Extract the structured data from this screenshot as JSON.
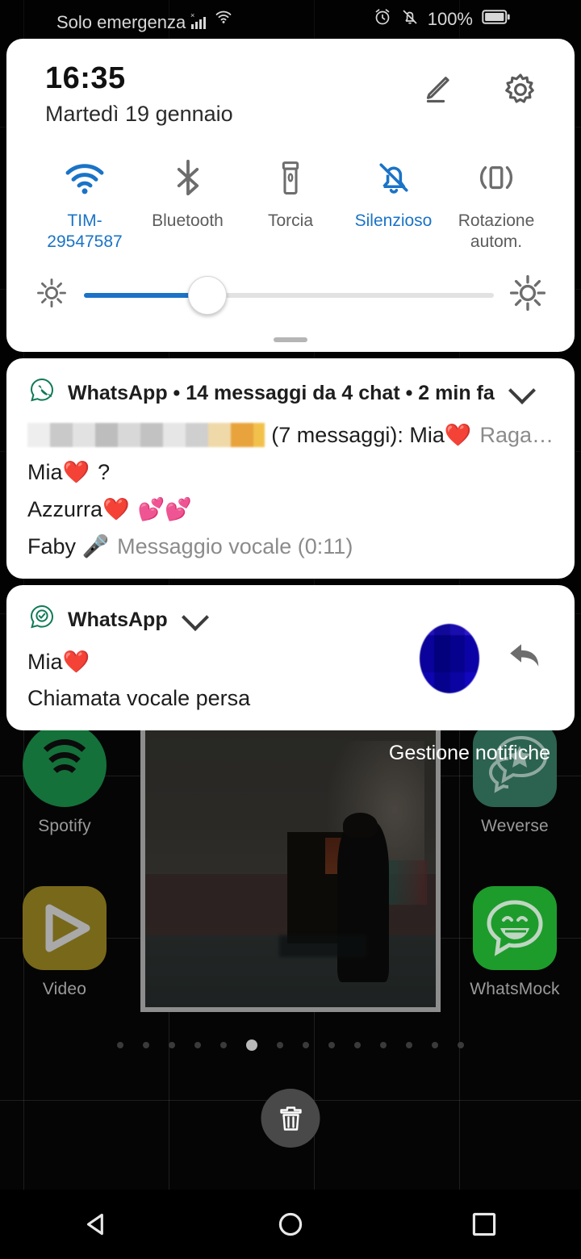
{
  "status_bar": {
    "carrier": "Solo emergenza",
    "signal_icon": "signal-bars-icon",
    "signal_x": "×",
    "wifi_icon": "wifi-icon",
    "alarm_icon": "alarm-icon",
    "silent_icon": "bell-off-icon",
    "battery_percent": "100%",
    "battery_icon": "battery-full-icon"
  },
  "quick_settings": {
    "time": "16:35",
    "date": "Martedì 19 gennaio",
    "edit_icon": "pencil-icon",
    "settings_icon": "gear-icon",
    "accent_color": "#1a73c7",
    "tiles": [
      {
        "label": "TIM-29547587",
        "icon": "wifi-icon",
        "active": true
      },
      {
        "label": "Bluetooth",
        "icon": "bluetooth-icon",
        "active": false
      },
      {
        "label": "Torcia",
        "icon": "flashlight-icon",
        "active": false
      },
      {
        "label": "Silenzioso",
        "icon": "bell-off-icon",
        "active": true
      },
      {
        "label": "Rotazione autom.",
        "icon": "screen-rotation-icon",
        "active": false
      }
    ],
    "brightness": {
      "low_icon": "brightness-low-icon",
      "high_icon": "brightness-high-icon",
      "value_percent": 30
    },
    "handle": "drag-handle"
  },
  "notifications": [
    {
      "app_icon": "whatsapp-icon",
      "header": "WhatsApp • 14 messaggi da 4 chat • 2 min fa",
      "expand_icon": "chevron-down-icon",
      "lines": [
        {
          "blurred_sender": true,
          "text": "(7 messaggi): Mia❤️",
          "preview": "Raga…"
        },
        {
          "blurred_sender": false,
          "text": "Mia❤️",
          "preview": "?"
        },
        {
          "blurred_sender": false,
          "text": "Azzurra❤️",
          "preview": "💕💕"
        },
        {
          "blurred_sender": false,
          "text": "Faby 🎤",
          "preview": "Messaggio vocale (0:11)"
        }
      ]
    },
    {
      "app_icon": "whatsapp-status-icon",
      "header": "WhatsApp",
      "expand_icon": "chevron-down-icon",
      "title": "Mia❤️",
      "body": "Chiamata vocale persa",
      "avatar": "blurred-contact-avatar",
      "reply_icon": "reply-arrow-icon"
    }
  ],
  "manage_notifications_label": "Gestione notifiche",
  "home_screen": {
    "apps": [
      {
        "label": "Spotify",
        "icon": "spotify-icon"
      },
      {
        "label": "Weverse",
        "icon": "weverse-icon"
      },
      {
        "label": "Video",
        "icon": "video-icon"
      },
      {
        "label": "WhatsMock",
        "icon": "whatsmock-icon"
      }
    ],
    "widget": {
      "name": "photo-widget"
    },
    "page_indicator": {
      "count": 14,
      "active_index": 5
    },
    "delete_target": {
      "icon": "trash-icon"
    }
  },
  "nav_bar": {
    "back": "back-triangle-icon",
    "home": "home-circle-icon",
    "recents": "recents-square-icon"
  }
}
